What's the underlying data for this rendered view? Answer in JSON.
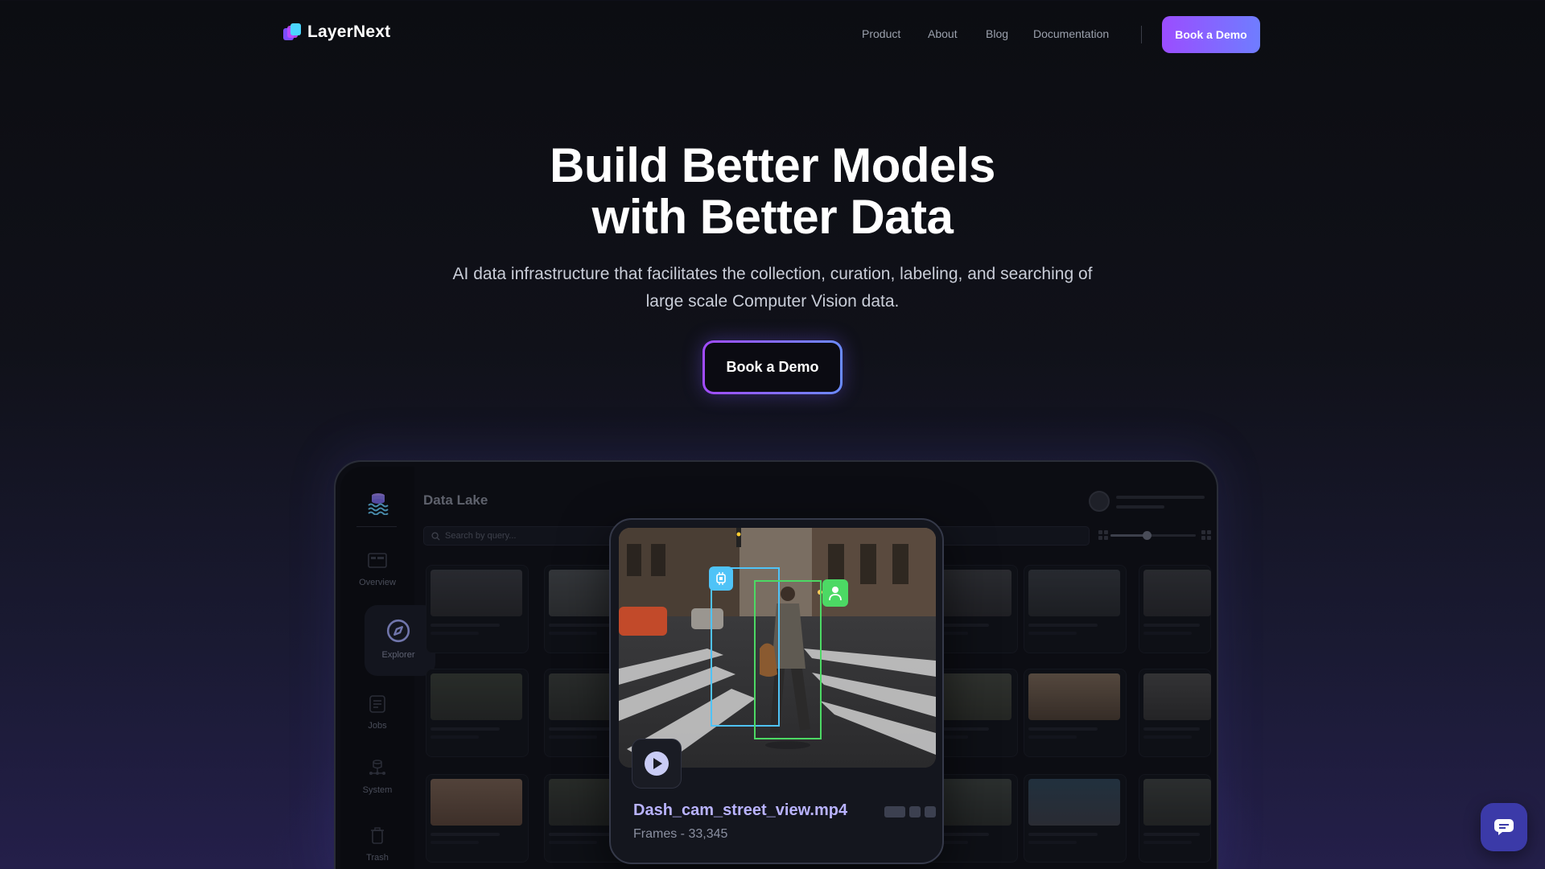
{
  "brand": {
    "name": "LayerNext"
  },
  "nav": {
    "items": [
      {
        "label": "Product"
      },
      {
        "label": "About"
      },
      {
        "label": "Blog"
      },
      {
        "label": "Documentation"
      }
    ],
    "cta_label": "Book a Demo"
  },
  "hero": {
    "title_line1": "Build Better Models",
    "title_line2": "with Better Data",
    "subtitle_line1": "AI data infrastructure that facilitates the collection, curation, labeling, and searching of",
    "subtitle_line2": "large scale Computer Vision data.",
    "cta_label": "Book a Demo"
  },
  "dashboard": {
    "title": "Data Lake",
    "search_placeholder": "Search by query...",
    "sidebar": [
      {
        "label": "Overview",
        "icon": "overview-icon"
      },
      {
        "label": "Explorer",
        "icon": "compass-icon",
        "active": true
      },
      {
        "label": "Jobs",
        "icon": "jobs-icon"
      },
      {
        "label": "System",
        "icon": "system-icon"
      },
      {
        "label": "Trash",
        "icon": "trash-icon"
      }
    ]
  },
  "video": {
    "filename": "Dash_cam_street_view.mp4",
    "frames_text": "Frames - 33,345"
  },
  "colors": {
    "accent_start": "#9b4dff",
    "accent_end": "#6f7dff",
    "bbox_blue": "#4fc3f7",
    "bbox_green": "#4cd964",
    "filename_color": "#b9b3ff"
  }
}
